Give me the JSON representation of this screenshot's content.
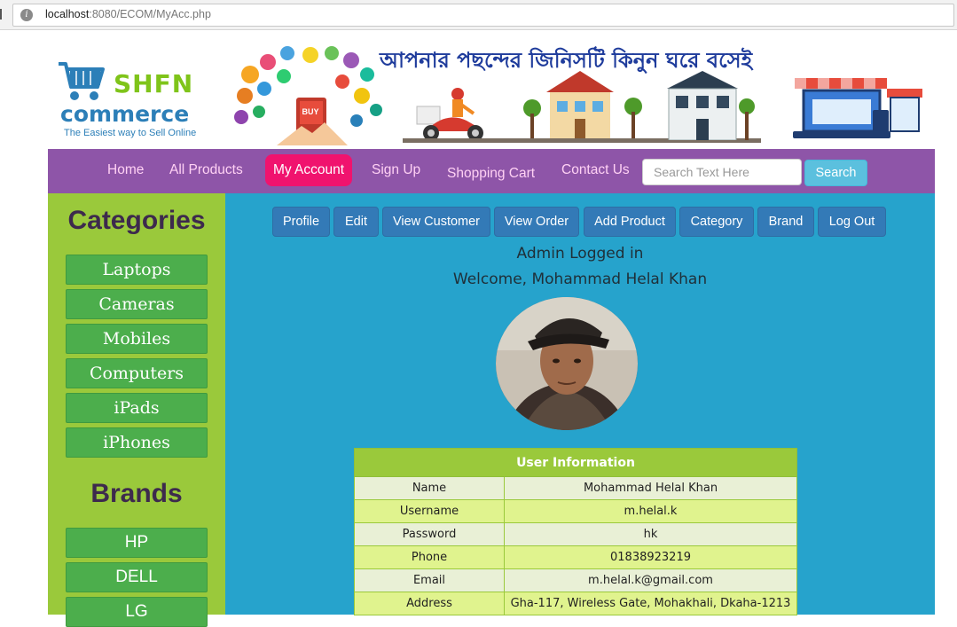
{
  "browser": {
    "url_host": "localhost",
    "url_path": ":8080/ECOM/MyAcc.php"
  },
  "banner": {
    "brand_top": "SHFN",
    "brand_bottom": "commerce",
    "tagline": "The Easiest way to Sell Online",
    "tagline_bn": "আপনার পছন্দের জিনিসটি কিনুন ঘরে বসেই",
    "buy_label": "BUY"
  },
  "nav": {
    "items": [
      "Home",
      "All Products",
      "My Account",
      "Sign Up",
      "Shopping Cart",
      "Contact Us"
    ],
    "search_placeholder": "Search Text Here",
    "search_button": "Search"
  },
  "sidebar": {
    "categories_title": "Categories",
    "categories": [
      "Laptops",
      "Cameras",
      "Mobiles",
      "Computers",
      "iPads",
      "iPhones"
    ],
    "brands_title": "Brands",
    "brands": [
      "HP",
      "DELL",
      "LG"
    ]
  },
  "main": {
    "tabs": [
      "Profile",
      "Edit",
      "View Customer",
      "View Order",
      "Add Product",
      "Category",
      "Brand",
      "Log Out"
    ],
    "admin_status": "Admin Logged in",
    "welcome": "Welcome, Mohammad Helal Khan",
    "table_title": "User Information",
    "rows": [
      {
        "label": "Name",
        "value": "Mohammad Helal Khan"
      },
      {
        "label": "Username",
        "value": "m.helal.k"
      },
      {
        "label": "Password",
        "value": "hk"
      },
      {
        "label": "Phone",
        "value": "01838923219"
      },
      {
        "label": "Email",
        "value": "m.helal.k@gmail.com"
      },
      {
        "label": "Address",
        "value": "Gha-117, Wireless Gate, Mohakhali, Dkaha-1213"
      }
    ]
  },
  "colors": {
    "nav_bg": "#8e55a8",
    "nav_active": "#f0136e",
    "sidebar_bg": "#9ac93b",
    "main_bg": "#26a3cc",
    "tab_button": "#337ab7",
    "category_button": "#4cae4c"
  }
}
